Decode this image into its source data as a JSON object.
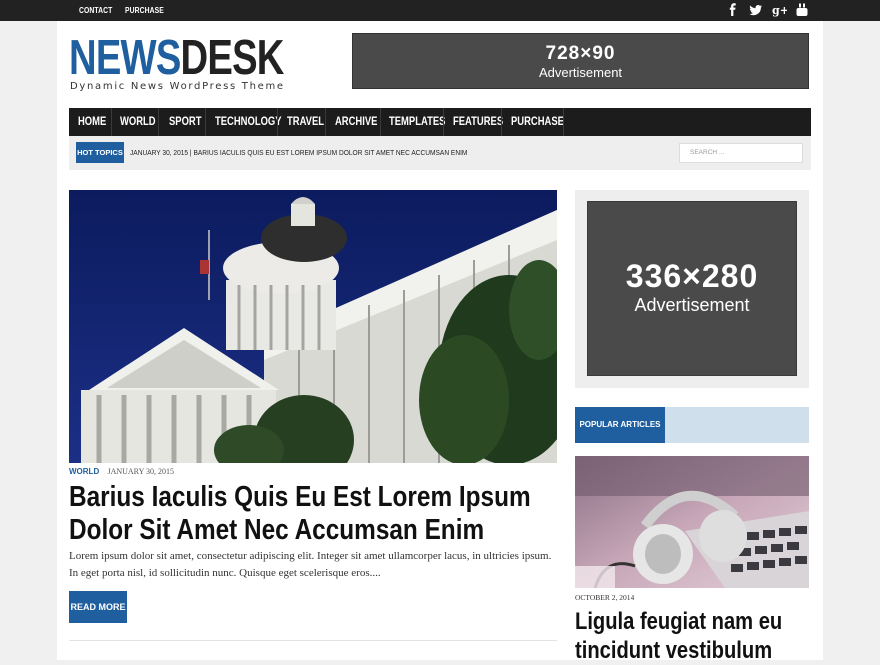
{
  "topbar": {
    "links": [
      "CONTACT",
      "PURCHASE"
    ],
    "social_icons": [
      "facebook-icon",
      "twitter-icon",
      "google-plus-icon",
      "youtube-icon"
    ]
  },
  "header": {
    "logo_part1": "NEWS",
    "logo_part2": "DESK",
    "tagline": "Dynamic News WordPress Theme",
    "ad": {
      "size": "728×90",
      "label": "Advertisement"
    }
  },
  "nav": {
    "items": [
      "HOME",
      "WORLD",
      "SPORT",
      "TECHNOLOGY",
      "TRAVEL",
      "ARCHIVE",
      "TEMPLATES",
      "FEATURES",
      "PURCHASE"
    ]
  },
  "hot_topics": {
    "label": "HOT TOPICS",
    "text": "JANUARY 30, 2015  |  BARIUS IACULIS QUIS EU EST LOREM IPSUM DOLOR SIT AMET NEC ACCUMSAN ENIM",
    "search_placeholder": "SEARCH ..."
  },
  "featured": {
    "category": "WORLD",
    "date": "JANUARY 30, 2015",
    "title": "Barius Iaculis Quis Eu Est Lorem Ipsum Dolor Sit Amet Nec Accumsan Enim",
    "excerpt": "Lorem ipsum dolor sit amet, consectetur adipiscing elit. Integer sit amet ullamcorper lacus, in ultricies ipsum. In eget porta nisl, id sollicitudin nunc. Quisque eget scelerisque eros....",
    "read_more": "READ MORE"
  },
  "sidebar": {
    "ad": {
      "size": "336×280",
      "label": "Advertisement"
    },
    "popular": {
      "heading": "POPULAR ARTICLES",
      "date": "OCTOBER 2, 2014",
      "title": "Ligula feugiat nam eu tincidunt vestibulum"
    }
  },
  "colors": {
    "accent": "#1f5f9f",
    "nav_bg": "#1c1c1c",
    "topbar_bg": "#222222"
  }
}
